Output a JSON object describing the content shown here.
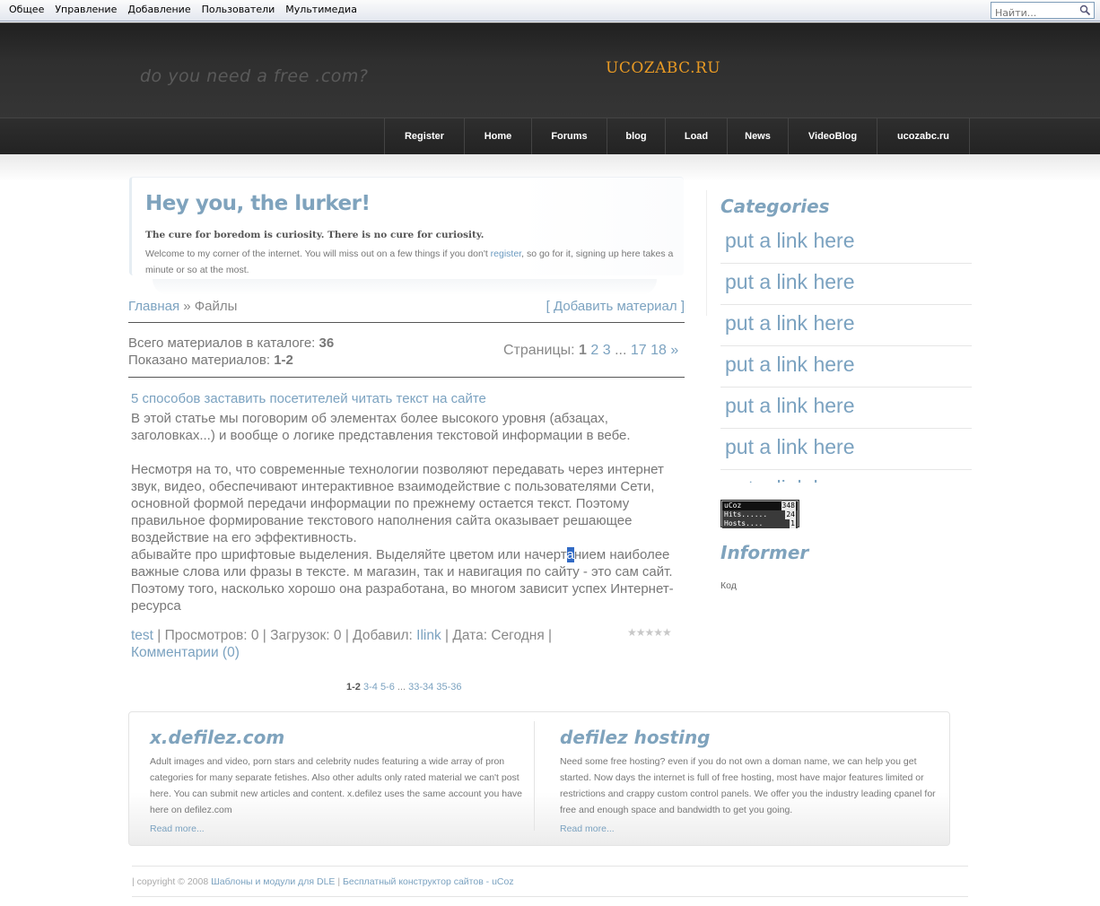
{
  "adminbar": {
    "menu": [
      "Общее",
      "Управление",
      "Добавление",
      "Пользователи",
      "Мультимедиа"
    ],
    "search_placeholder": "Найти..."
  },
  "header": {
    "tagline": "do you need a free .com?",
    "site_name": "UCOZABC.RU"
  },
  "nav": [
    "Register",
    "Home",
    "Forums",
    "blog",
    "Load",
    "News",
    "VideoBlog",
    "ucozabc.ru"
  ],
  "lurker": {
    "title": "Hey you, the lurker!",
    "bold": "The cure for boredom is curiosity. There is no cure for curiosity.",
    "text_before": "Welcome to my corner of the internet. You will miss out on a few things if you don't ",
    "link": "register",
    "text_after": ", so go for it, signing up here takes a minute or so at the most."
  },
  "breadcrumb": {
    "home": "Главная",
    "sep": " » ",
    "current": "Файлы",
    "add": "[ Добавить материал ]"
  },
  "stats": {
    "total_label": "Всего материалов в каталоге: ",
    "total": "36",
    "shown_label": "Показано материалов: ",
    "shown": "1-2"
  },
  "pages": {
    "label": "Страницы: ",
    "current": "1",
    "p2": "2",
    "p3": "3",
    "dots": " ... ",
    "p17": "17",
    "p18": "18",
    "next": "»"
  },
  "article": {
    "title": "5 способов заставить посетителей читать текст на сайте",
    "para1": "В этой статье мы поговорим об элементах более высокого уровня (абзацах, заголовках...) и вообще о логике представления текстовой информации в вебе.",
    "para2": "Несмотря на то, что современные технологии позволяют передавать через интернет звук, видео, обеспечивают интерактивное взаимодействие с пользователями Сети, основной формой передачи информации по прежнему остается текст. Поэтому правильное формирование текстового наполнения сайта оказывает решающее воздействие на его эффективность.",
    "para3_a": "абывайте про шрифтовые выделения. Выделяйте цветом или начерт",
    "para3_hl": "а",
    "para3_b": "нием наиболее важные слова или фразы в тексте. м магазин, так и навигация по сайту - это сам сайт. Поэтому того, насколько хорошо она разработана, во многом зависит успех Интернет-ресурса",
    "category": "test",
    "views": " | Просмотров: 0 | Загрузок: 0 | Добавил: ",
    "author": "Ilink",
    "date": " | Дата: Сегодня | ",
    "comments": "Комментарии (0)",
    "stars": "★★★★★"
  },
  "pager": {
    "current": "1-2",
    "p2": "3-4",
    "p3": "5-6",
    "dots": "...",
    "p17": "33-34",
    "p18": "35-36"
  },
  "sidebar": {
    "categories_title": "Categories",
    "links": [
      "put a link here",
      "put a link here",
      "put a link here",
      "put a link here",
      "put a link here",
      "put a link here",
      "put a link here"
    ],
    "counter": {
      "brand": "uCoz",
      "total": "348",
      "hits_label": "Hits......",
      "hits": "24",
      "hosts_label": "Hosts....",
      "hosts": "1"
    },
    "informer_title": "Informer",
    "code": "Код"
  },
  "bottom": {
    "col1": {
      "title": "x.defilez.com",
      "text": "Adult images and video, porn stars and celebrity nudes featuring a wide array of pron categories for many separate fetishes. Also other adults only rated material we can't post here. You can submit new articles and content. x.defilez uses the same account you have here on defilez.com",
      "more": "Read more..."
    },
    "col2": {
      "title": "defilez hosting",
      "text": "Need some free hosting? even if you do not own a doman name, we can help you get started. Now days the internet is full of free hosting, most have major features limited or restrictions and crappy custom control panels. We offer you the industry leading cpanel for free and enough space and bandwidth to get you going.",
      "more": "Read more..."
    }
  },
  "footer": {
    "copy": "| copyright © 2008 ",
    "link1": "Шаблоны и модули для DLE",
    "sep": " | ",
    "link2": "Бесплатный конструктор сайтов - uCoz"
  }
}
